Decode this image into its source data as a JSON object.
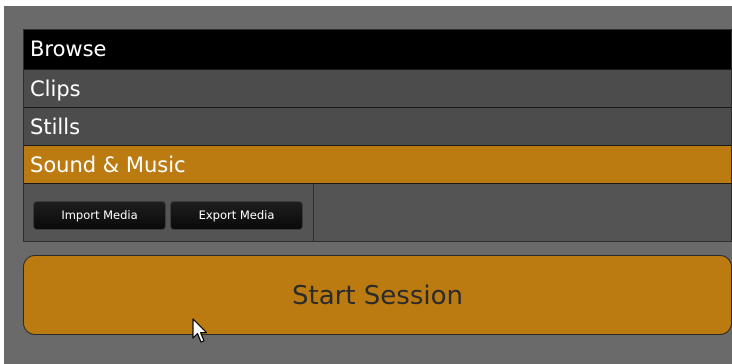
{
  "browser_panel": {
    "header": "Browse",
    "items": [
      {
        "label": "Clips",
        "selected": false
      },
      {
        "label": "Stills",
        "selected": false
      },
      {
        "label": "Sound & Music",
        "selected": true
      }
    ],
    "toolbar": {
      "import_label": "Import Media",
      "export_label": "Export Media"
    }
  },
  "start_session": {
    "label": "Start Session"
  },
  "colors": {
    "accent": "#bc7b10",
    "background": "#6a6a6a",
    "header": "#000000"
  },
  "icons": {
    "cursor": "mouse-pointer-icon"
  }
}
